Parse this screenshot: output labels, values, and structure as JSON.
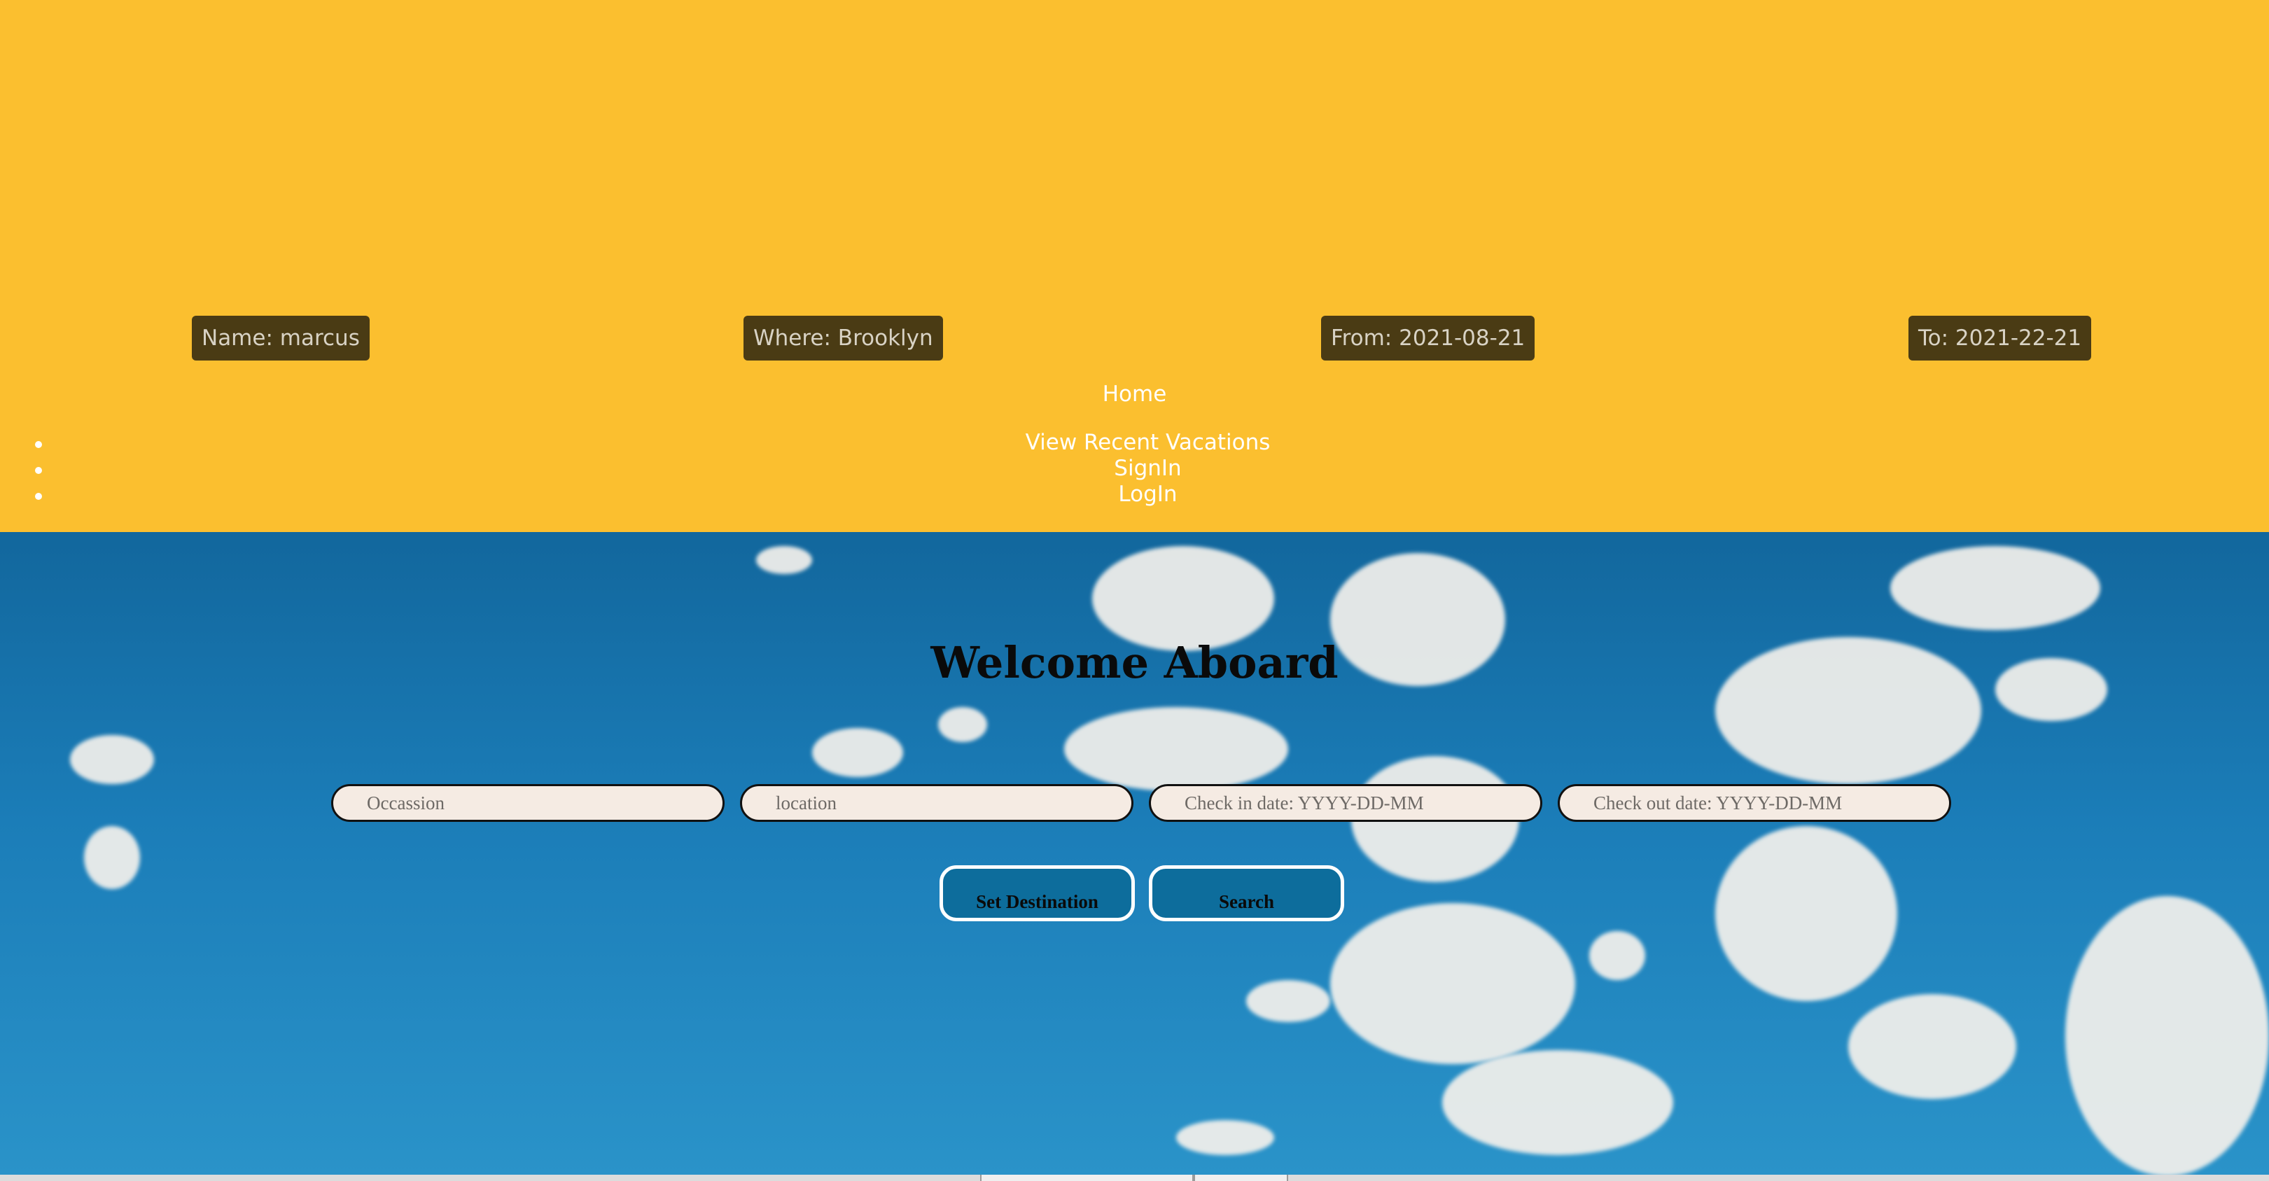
{
  "header": {
    "badges": {
      "name": "Name: marcus",
      "where": "Where: Brooklyn",
      "from": "From: 2021-08-21",
      "to": "To: 2021-22-21"
    },
    "nav": {
      "home": "Home",
      "items": [
        "View Recent Vacations",
        "SignIn",
        "LogIn"
      ]
    }
  },
  "hero": {
    "title": "Welcome Aboard",
    "fields": {
      "occasion_placeholder": "Occassion",
      "location_placeholder": "location",
      "checkin_placeholder": "Check in date: YYYY-DD-MM",
      "checkout_placeholder": "Check out date: YYYY-DD-MM"
    },
    "buttons": {
      "set_destination": "Set Destination",
      "search": "Search"
    }
  },
  "colors": {
    "header_bg": "#fbbf2f",
    "badge_bg": "#4a3b14",
    "sky": "#1b7db8",
    "field_bg": "#f5ebe3"
  }
}
